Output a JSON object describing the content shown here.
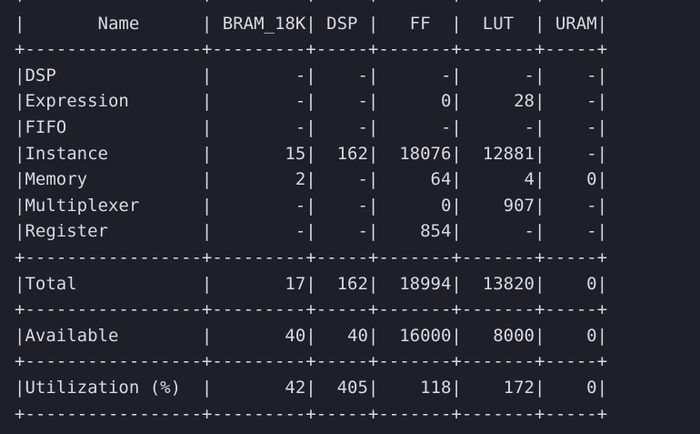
{
  "report": {
    "lines": [
      "+-----------------+---------+-----+-------+-------+-----+",
      "|       Name      | BRAM_18K| DSP |   FF  |  LUT  | URAM|",
      "+-----------------+---------+-----+-------+-------+-----+",
      "|DSP              |        -|    -|      -|      -|    -|",
      "|Expression       |        -|    -|      0|     28|    -|",
      "|FIFO             |        -|    -|      -|      -|    -|",
      "|Instance         |       15|  162|  18076|  12881|    -|",
      "|Memory           |        2|    -|     64|      4|    0|",
      "|Multiplexer      |        -|    -|      0|    907|    -|",
      "|Register         |        -|    -|    854|      -|    -|",
      "+-----------------+---------+-----+-------+-------+-----+",
      "|Total            |       17|  162|  18994|  13820|    0|",
      "+-----------------+---------+-----+-------+-------+-----+",
      "|Available        |       40|   40|  16000|   8000|    0|",
      "+-----------------+---------+-----+-------+-------+-----+",
      "|Utilization (%)  |       42|  405|    118|    172|    0|",
      "+-----------------+---------+-----+-------+-------+-----+"
    ]
  },
  "colors": {
    "background": "#1e1f29",
    "text": "#d8dadf"
  }
}
